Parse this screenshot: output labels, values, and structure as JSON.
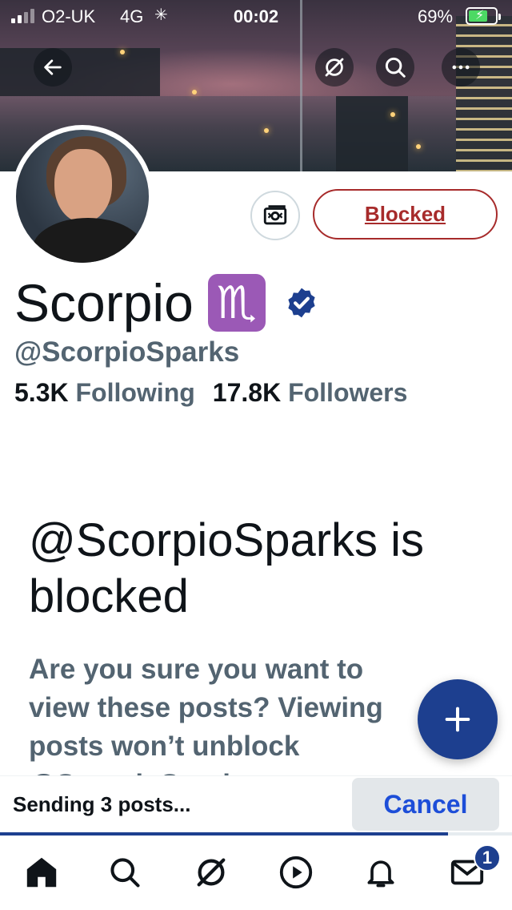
{
  "status_bar": {
    "carrier": "O2-UK",
    "network": "4G",
    "time": "00:02",
    "battery_percent": "69%",
    "battery_level": 0.69,
    "charging": true
  },
  "navigation": {
    "back_icon": "back-arrow-icon",
    "grok_icon": "grok-icon",
    "search_icon": "search-icon",
    "more_icon": "more-icon"
  },
  "profile": {
    "name": "Scorpio",
    "zodiac_emoji": "♏",
    "verified": true,
    "handle": "@ScorpioSparks",
    "following_count": "5.3K",
    "following_label": "Following",
    "followers_count": "17.8K",
    "followers_label": "Followers",
    "block_button_label": "Blocked"
  },
  "blocked_notice": {
    "title": "@ScorpioSparks is blocked",
    "description": "Are you sure you want to view these posts? Viewing posts won’t unblock @ScorpioSparks."
  },
  "sending_bar": {
    "text": "Sending 3 posts...",
    "cancel_label": "Cancel",
    "progress": 0.875
  },
  "tab_bar": {
    "items": [
      "home-icon",
      "search-icon",
      "grok-icon",
      "video-icon",
      "notifications-icon",
      "messages-icon"
    ],
    "messages_badge": "1"
  },
  "colors": {
    "accent": "#1d3f8f",
    "blocked_red": "#a72b2b",
    "secondary_text": "#536471",
    "cancel_blue": "#1d4ed8"
  }
}
